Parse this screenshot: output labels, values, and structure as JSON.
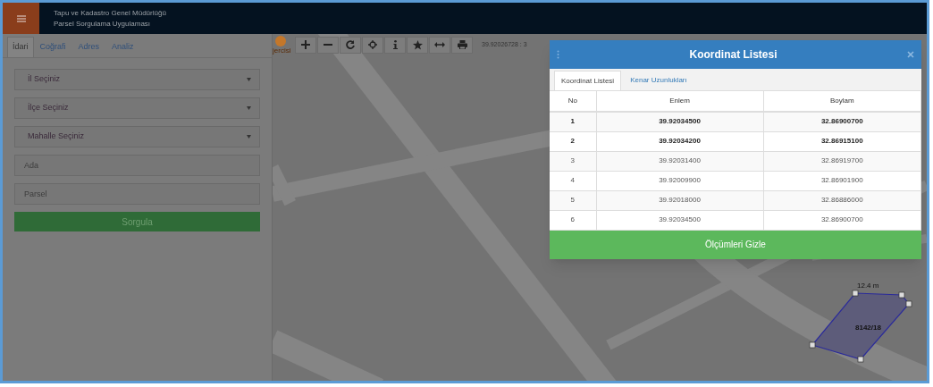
{
  "header": {
    "title": "Tapu ve Kadastro Genel Müdürlüğü",
    "subtitle": "Parsel Sorgulama Uygulaması"
  },
  "sidebar": {
    "tabs": [
      {
        "label": "İdari",
        "selected": true
      },
      {
        "label": "Coğrafi",
        "selected": false
      },
      {
        "label": "Adres",
        "selected": false
      },
      {
        "label": "Analiz",
        "selected": false
      }
    ],
    "fields": [
      {
        "kind": "select",
        "value": "İl Seçiniz"
      },
      {
        "kind": "select",
        "value": "İlçe Seçiniz"
      },
      {
        "kind": "select",
        "value": "Mahalle Seçiniz"
      },
      {
        "kind": "input",
        "placeholder": "Ada"
      },
      {
        "kind": "input",
        "placeholder": "Parsel"
      }
    ],
    "button": "Sorgula"
  },
  "map": {
    "logo_text": "jercisi",
    "coordinates": "39.92026728 : 3",
    "parcel": {
      "label": "8142/18",
      "edge_length": "12.4 m"
    }
  },
  "dialog": {
    "title": "Koordinat Listesi",
    "tabs": [
      {
        "label": "Koordinat Listesi",
        "selected": true
      },
      {
        "label": "Kenar Uzunlukları",
        "selected": false
      }
    ],
    "table": {
      "columns": [
        "No",
        "Enlem",
        "Boylam"
      ],
      "rows": [
        {
          "cells": [
            "1",
            "39.92034500",
            "32.86900700"
          ],
          "bold": true
        },
        {
          "cells": [
            "2",
            "39.92034200",
            "32.86915100"
          ],
          "bold": true
        },
        {
          "cells": [
            "3",
            "39.92031400",
            "32.86919700"
          ],
          "bold": false
        },
        {
          "cells": [
            "4",
            "39.92009900",
            "32.86901900"
          ],
          "bold": false
        },
        {
          "cells": [
            "5",
            "39.92018000",
            "32.86886000"
          ],
          "bold": false
        },
        {
          "cells": [
            "6",
            "39.92034500",
            "32.86900700"
          ],
          "bold": false
        }
      ]
    },
    "button": "Ölçümleri Gizle"
  }
}
